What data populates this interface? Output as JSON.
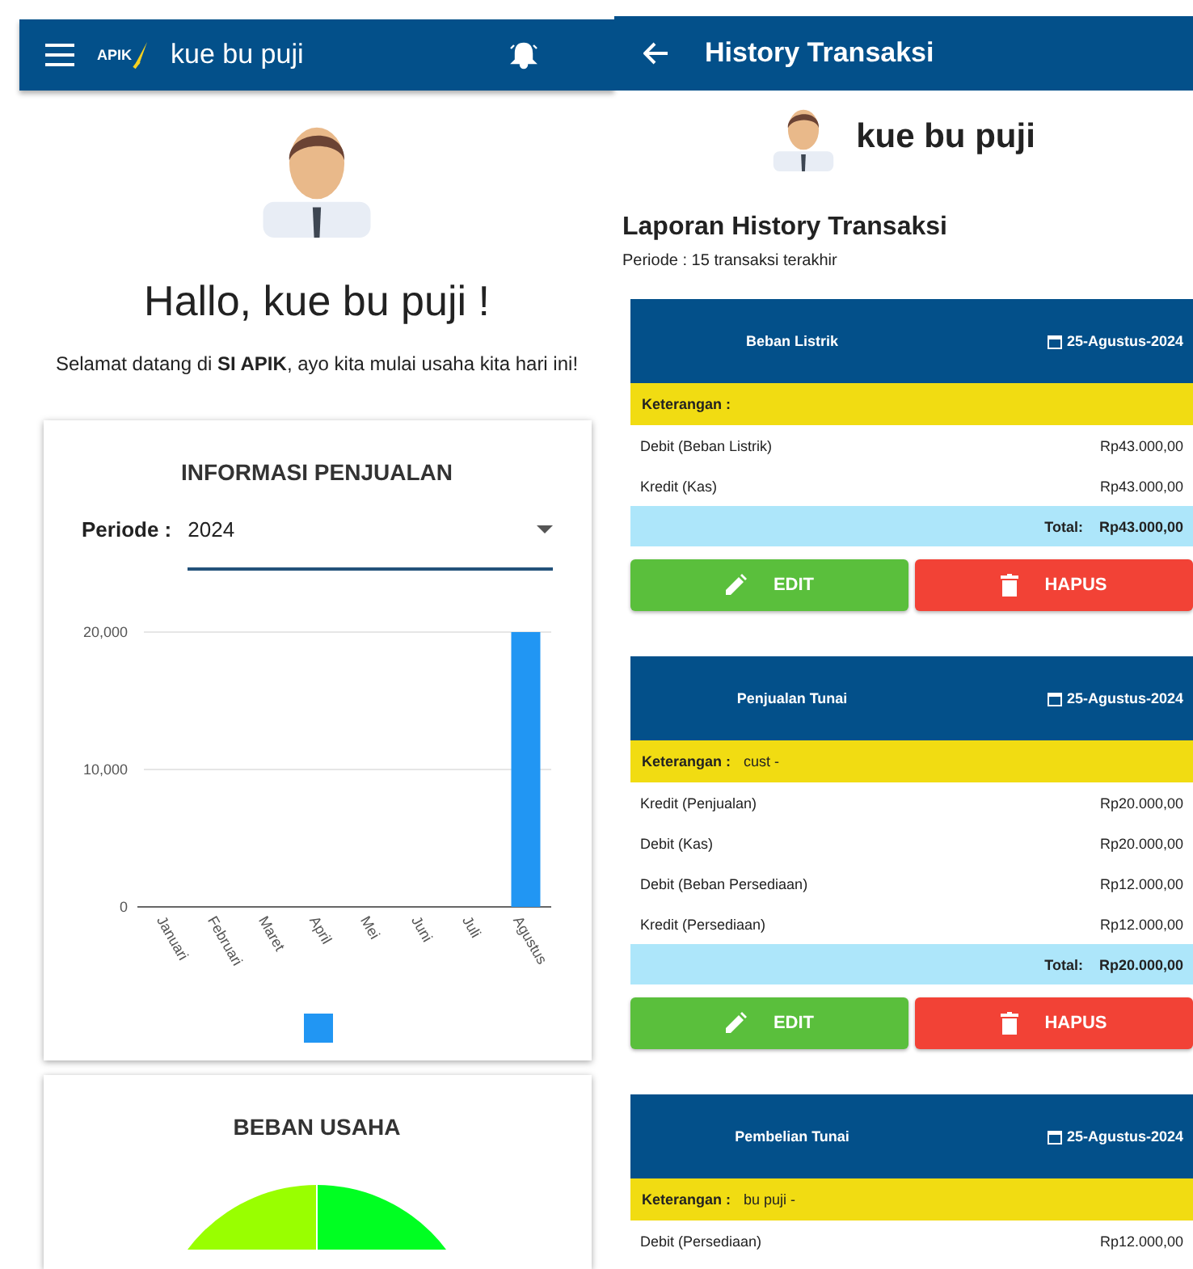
{
  "left": {
    "app_bar": {
      "logo_text": "APIK",
      "title": "kue bu puji"
    },
    "greeting": "Hallo, kue bu puji !",
    "welcome": "Selamat datang di **SI APIK**, ayo kita mulai usaha kita hari ini!",
    "sales_card": {
      "title": "INFORMASI PENJUALAN",
      "period_label": "Periode :",
      "period_value": "2024",
      "chart_data": {
        "type": "bar",
        "categories": [
          "Januari",
          "Februari",
          "Maret",
          "April",
          "Mei",
          "Juni",
          "Juli",
          "Agustus"
        ],
        "series": [
          {
            "color": "#2196f3",
            "values": [
              0,
              0,
              0,
              0,
              0,
              0,
              0,
              20000
            ]
          }
        ],
        "ylim": [
          0,
          20000
        ],
        "yticks": [
          {
            "value": 0,
            "label": "0"
          },
          {
            "value": 10000,
            "label": "10,000"
          },
          {
            "value": 20000,
            "label": "20,000"
          }
        ]
      }
    },
    "expense_card": {
      "title": "BEBAN USAHA"
    }
  },
  "right": {
    "app_bar": {
      "title": "History Transaksi"
    },
    "profile_name": "kue bu puji",
    "report_title": "Laporan History Transaksi",
    "report_period": "Periode : 15 transaksi terakhir",
    "transactions": [
      {
        "title": "Beban Listrik",
        "date": "25-Agustus-2024",
        "note_label": "Keterangan :",
        "entries": [
          {
            "account": "Debit (Beban Listrik)",
            "amount": "Rp43.000,00"
          },
          {
            "account": "Kredit (Kas)",
            "amount": "Rp43.000,00"
          }
        ],
        "total_label": "Total:",
        "total": "Rp43.000,00",
        "edit_label": "EDIT",
        "delete_label": "HAPUS"
      },
      {
        "title": "Penjualan Tunai",
        "date": "25-Agustus-2024",
        "note_label": "Keterangan :",
        "note": "cust -",
        "entries": [
          {
            "account": "Kredit (Penjualan)",
            "amount": "Rp20.000,00"
          },
          {
            "account": "Debit (Kas)",
            "amount": "Rp20.000,00"
          },
          {
            "account": "Debit (Beban Persediaan)",
            "amount": "Rp12.000,00"
          },
          {
            "account": "Kredit (Persediaan)",
            "amount": "Rp12.000,00"
          }
        ],
        "total_label": "Total:",
        "total": "Rp20.000,00",
        "edit_label": "EDIT",
        "delete_label": "HAPUS"
      },
      {
        "title": "Pembelian Tunai",
        "date": "25-Agustus-2024",
        "note_label": "Keterangan :",
        "note": "bu puji -",
        "entries": [
          {
            "account": "Debit (Persediaan)",
            "amount": "Rp12.000,00"
          }
        ]
      }
    ]
  }
}
